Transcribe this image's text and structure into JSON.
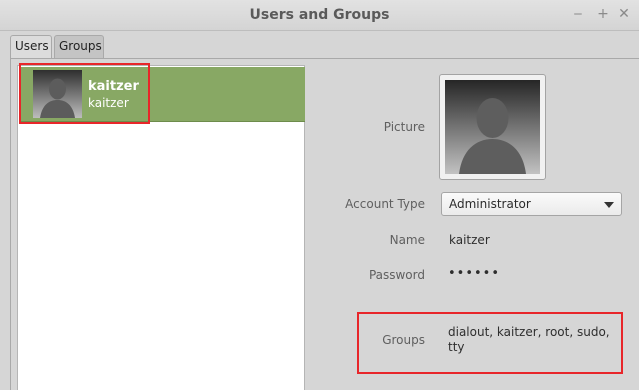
{
  "window": {
    "title": "Users and Groups",
    "controls": {
      "minimize": "‒",
      "maximize": "+",
      "close": "✕"
    }
  },
  "tabs": [
    {
      "label": "Users",
      "selected": true
    },
    {
      "label": "Groups",
      "selected": false
    }
  ],
  "users": [
    {
      "display_name": "kaitzer",
      "username": "kaitzer",
      "avatar_icon": "user-silhouette-icon",
      "selected": true
    }
  ],
  "details": {
    "picture_label": "Picture",
    "account_type_label": "Account Type",
    "account_type_value": "Administrator",
    "name_label": "Name",
    "name_value": "kaitzer",
    "password_label": "Password",
    "password_value": "••••••",
    "groups_label": "Groups",
    "groups_value": "dialout, kaitzer, root, sudo, tty"
  },
  "colors": {
    "selection": "#88a864",
    "highlight": "#e8262a",
    "window_bg": "#d6d6d6"
  }
}
